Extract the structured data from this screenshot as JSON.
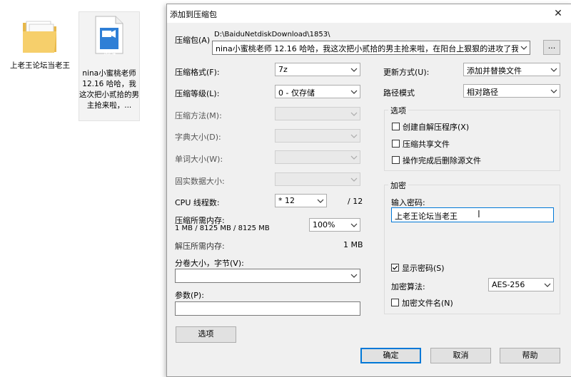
{
  "desktop": {
    "items": [
      {
        "icon": "folder-icon",
        "label": "上老王论坛当老王"
      },
      {
        "icon": "mp4-file-icon",
        "badge": "MP4",
        "label": "nina小蜜桃老师 12.16 哈哈，我这次把小贰拾的男主抢来啦，..."
      }
    ]
  },
  "dialog": {
    "title": "添加到压缩包",
    "close_glyph": "✕",
    "archive": {
      "label": "压缩包(A)",
      "path": "D:\\BaiduNetdiskDownload\\1853\\",
      "filename": "nina小蜜桃老师 12.16 哈哈，我这次把小贰拾的男主抢来啦，在阳台上狠狠的进攻了我，真",
      "browse_label": "..."
    },
    "left": {
      "format": {
        "label": "压缩格式(F):",
        "value": "7z"
      },
      "level": {
        "label": "压缩等级(L):",
        "value": "0 - 仅存储"
      },
      "method": {
        "label": "压缩方法(M):",
        "value": ""
      },
      "dict": {
        "label": "字典大小(D):",
        "value": ""
      },
      "word": {
        "label": "单词大小(W):",
        "value": ""
      },
      "solid": {
        "label": "固实数据大小:",
        "value": ""
      },
      "threads": {
        "label": "CPU 线程数:",
        "value": "* 12",
        "max": "/ 12"
      },
      "compress_mem": {
        "label": "压缩所需内存:",
        "detail": "1 MB / 8125 MB / 8125 MB",
        "percent": "100%"
      },
      "decompress_mem": {
        "label": "解压所需内存:",
        "value": "1 MB"
      },
      "volume": {
        "label": "分卷大小，字节(V):",
        "value": ""
      },
      "params": {
        "label": "参数(P):",
        "value": ""
      },
      "options_button": "选项"
    },
    "right": {
      "update": {
        "label": "更新方式(U):",
        "value": "添加并替换文件"
      },
      "path_mode": {
        "label": "路径模式",
        "value": "相对路径"
      },
      "options_group": {
        "title": "选项",
        "checks": [
          {
            "label": "创建自解压程序(X)",
            "checked": false
          },
          {
            "label": "压缩共享文件",
            "checked": false
          },
          {
            "label": "操作完成后删除源文件",
            "checked": false
          }
        ]
      },
      "encryption": {
        "title": "加密",
        "password_label": "输入密码:",
        "password_value": "上老王论坛当老王",
        "show_password": {
          "label": "显示密码(S)",
          "checked": true
        },
        "algo_label": "加密算法:",
        "algo_value": "AES-256",
        "encrypt_names": {
          "label": "加密文件名(N)",
          "checked": false
        }
      }
    },
    "buttons": {
      "ok": "确定",
      "cancel": "取消",
      "help": "帮助"
    }
  }
}
